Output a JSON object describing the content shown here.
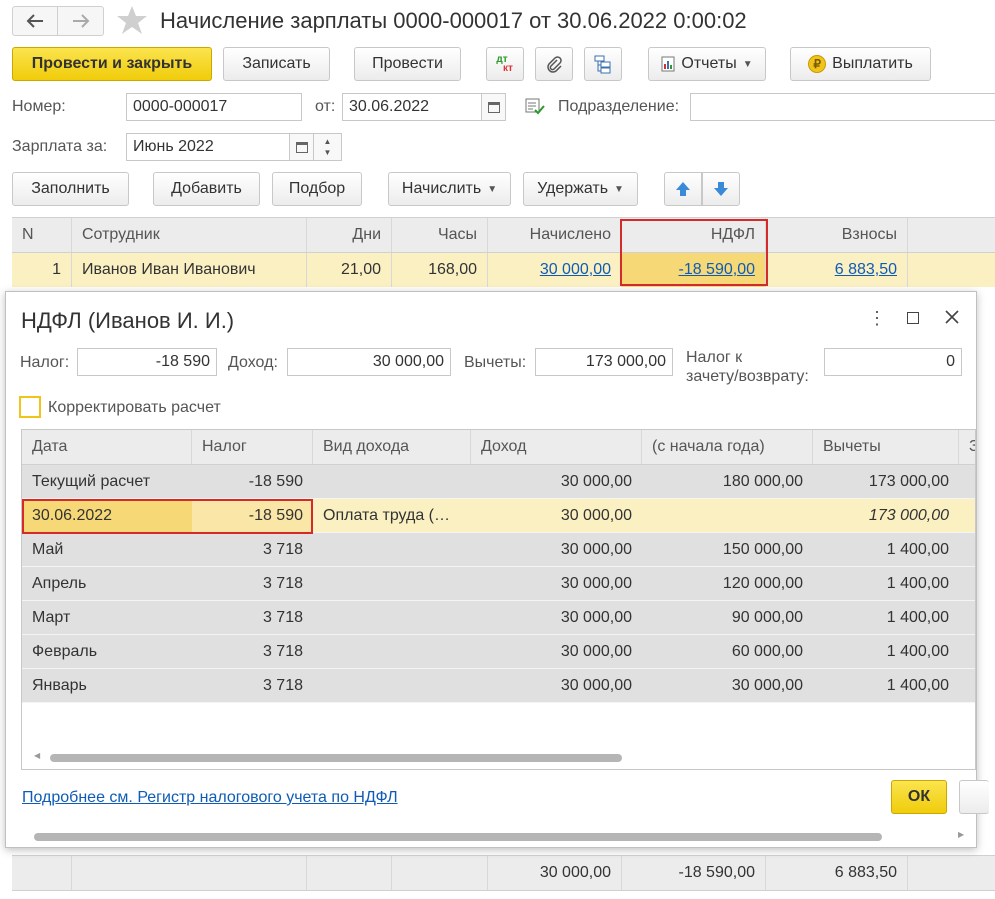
{
  "title": "Начисление зарплаты 0000-000017 от 30.06.2022 0:00:02",
  "toolbar": {
    "post_close": "Провести и закрыть",
    "save": "Записать",
    "post": "Провести",
    "dtkt_top": "дт",
    "dtkt_bottom": "кт",
    "reports": "Отчеты",
    "pay": "Выплатить"
  },
  "header": {
    "number_label": "Номер:",
    "number_value": "0000-000017",
    "from_label": "от:",
    "date_value": "30.06.2022",
    "division_label": "Подразделение:",
    "salary_for_label": "Зарплата за:",
    "salary_for_value": "Июнь 2022"
  },
  "actions": {
    "fill": "Заполнить",
    "add": "Добавить",
    "pick": "Подбор",
    "accrue": "Начислить",
    "withhold": "Удержать"
  },
  "main_table": {
    "columns": [
      "N",
      "Сотрудник",
      "Дни",
      "Часы",
      "Начислено",
      "НДФЛ",
      "Взносы"
    ],
    "row": {
      "n": "1",
      "employee": "Иванов Иван Иванович",
      "days": "21,00",
      "hours": "168,00",
      "accrued": "30 000,00",
      "ndfl": "-18 590,00",
      "contributions": "6 883,50"
    },
    "totals": {
      "accrued": "30 000,00",
      "ndfl": "-18 590,00",
      "contributions": "6 883,50"
    }
  },
  "dialog": {
    "title": "НДФЛ (Иванов И. И.)",
    "tax_label": "Налог:",
    "tax_value": "-18 590",
    "income_label": "Доход:",
    "income_value": "30 000,00",
    "deductions_label": "Вычеты:",
    "deductions_value": "173 000,00",
    "offset_label_1": "Налог к",
    "offset_label_2": "зачету/возврату:",
    "offset_value": "0",
    "correct_label": "Корректировать расчет",
    "columns": [
      "Дата",
      "Налог",
      "Вид дохода",
      "Доход",
      "(с начала года)",
      "Вычеты",
      "З"
    ],
    "rows": [
      {
        "date": "Текущий расчет",
        "tax": "-18 590",
        "kind": "",
        "income": "30 000,00",
        "ytd": "180 000,00",
        "ded": "173 000,00"
      },
      {
        "date": "30.06.2022",
        "tax": "-18 590",
        "kind": "Оплата труда (…",
        "income": "30 000,00",
        "ytd": "",
        "ded": "173 000,00"
      },
      {
        "date": "Май",
        "tax": "3 718",
        "kind": "",
        "income": "30 000,00",
        "ytd": "150 000,00",
        "ded": "1 400,00"
      },
      {
        "date": "Апрель",
        "tax": "3 718",
        "kind": "",
        "income": "30 000,00",
        "ytd": "120 000,00",
        "ded": "1 400,00"
      },
      {
        "date": "Март",
        "tax": "3 718",
        "kind": "",
        "income": "30 000,00",
        "ytd": "90 000,00",
        "ded": "1 400,00"
      },
      {
        "date": "Февраль",
        "tax": "3 718",
        "kind": "",
        "income": "30 000,00",
        "ytd": "60 000,00",
        "ded": "1 400,00"
      },
      {
        "date": "Январь",
        "tax": "3 718",
        "kind": "",
        "income": "30 000,00",
        "ytd": "30 000,00",
        "ded": "1 400,00"
      }
    ],
    "link": "Подробнее см. Регистр налогового учета по НДФЛ",
    "ok": "ОК"
  }
}
